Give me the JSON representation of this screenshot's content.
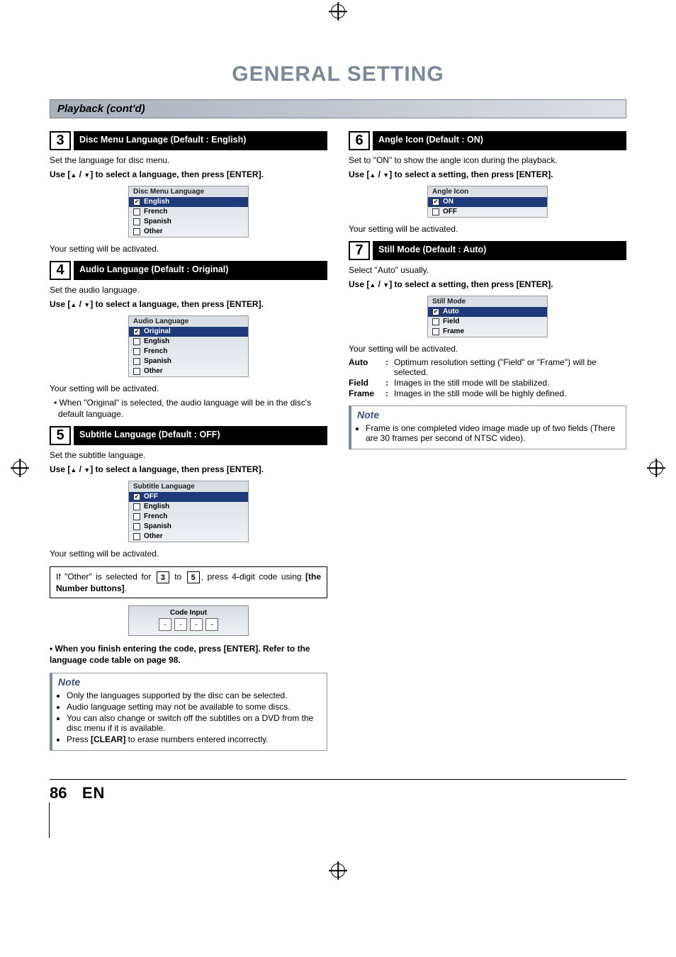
{
  "page_title": "GENERAL SETTING",
  "section_bar": "Playback (cont'd)",
  "page_number": "86",
  "page_lang": "EN",
  "left": {
    "step3": {
      "num": "3",
      "title": "Disc Menu Language (Default : English)",
      "intro": "Set the language for disc menu.",
      "instruction_pre": "Use [",
      "instruction_mid": " / ",
      "instruction_post": "] to select a language, then press [ENTER].",
      "osd_title": "Disc Menu Language",
      "osd_items": [
        "English",
        "French",
        "Spanish",
        "Other"
      ],
      "outro": "Your setting will be activated."
    },
    "step4": {
      "num": "4",
      "title": "Audio Language (Default : Original)",
      "intro": "Set the audio language.",
      "instruction_pre": "Use [",
      "instruction_mid": " / ",
      "instruction_post": "] to select a language, then press [ENTER].",
      "osd_title": "Audio Language",
      "osd_items": [
        "Original",
        "English",
        "French",
        "Spanish",
        "Other"
      ],
      "outro": "Your setting will be activated.",
      "bullet": "When \"Original\" is selected, the audio language will be in the disc's default language."
    },
    "step5": {
      "num": "5",
      "title": "Subtitle Language (Default : OFF)",
      "intro": "Set the subtitle language.",
      "instruction_pre": "Use [",
      "instruction_mid": " / ",
      "instruction_post": "] to select a language, then press [ENTER].",
      "osd_title": "Subtitle Language",
      "osd_items": [
        "OFF",
        "English",
        "French",
        "Spanish",
        "Other"
      ],
      "outro": "Your setting will be activated."
    },
    "other_note_a": "If \"Other\" is selected for ",
    "other_note_b": " to ",
    "other_note_c": ", press 4-digit code using ",
    "other_note_d": "[the Number buttons]",
    "other_note_e": ".",
    "other_box3": "3",
    "other_box5": "5",
    "code_title": "Code Input",
    "code_placeholder": "-",
    "after_code_1": "• When you finish entering the code, press [ENTER]. Refer to the language code table on page 98.",
    "note_title": "Note",
    "notes": [
      "Only the languages supported by the disc can be selected.",
      "Audio language setting may not be available to some discs.",
      "You can also change or switch off the subtitles on a DVD from the disc menu if it is available.",
      "Press [CLEAR] to erase numbers entered incorrectly."
    ],
    "note4_pre": "Press ",
    "note4_bold": "[CLEAR]",
    "note4_post": " to erase numbers entered incorrectly."
  },
  "right": {
    "step6": {
      "num": "6",
      "title": "Angle Icon (Default : ON)",
      "intro": "Set to \"ON\" to show the angle icon during the playback.",
      "instruction_pre": "Use [",
      "instruction_mid": " / ",
      "instruction_post": "] to select a setting, then press [ENTER].",
      "osd_title": "Angle Icon",
      "osd_items": [
        "ON",
        "OFF"
      ],
      "outro": "Your setting will be activated."
    },
    "step7": {
      "num": "7",
      "title": "Still Mode (Default : Auto)",
      "intro": "Select \"Auto\" usually.",
      "instruction_pre": "Use [",
      "instruction_mid": " / ",
      "instruction_post": "] to select a setting, then press [ENTER].",
      "osd_title": "Still Mode",
      "osd_items": [
        "Auto",
        "Field",
        "Frame"
      ],
      "outro": "Your setting will be activated.",
      "defs": [
        {
          "term": "Auto",
          "def": "Optimum resolution setting (\"Field\" or \"Frame\") will be selected."
        },
        {
          "term": "Field",
          "def": "Images in the still mode will be stabilized."
        },
        {
          "term": "Frame",
          "def": "Images in the still mode will be highly defined."
        }
      ]
    },
    "note_title": "Note",
    "note_item": "Frame is one completed video image made up of two fields (There are 30 frames per second of NTSC video)."
  }
}
